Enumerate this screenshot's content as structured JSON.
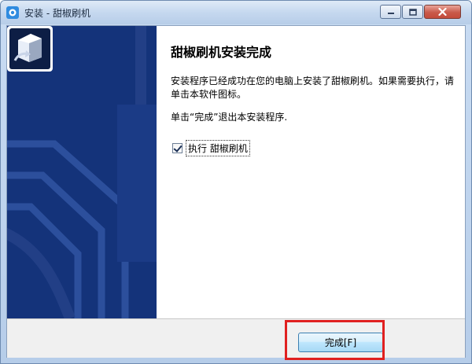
{
  "window": {
    "title": "安装 - 甜椒刷机",
    "icon": "installer-app-icon",
    "controls": [
      "minimize",
      "maximize",
      "close"
    ]
  },
  "page": {
    "heading": "甜椒刷机安装完成",
    "paragraph1": "安装程序已经成功在您的电脑上安装了甜椒刷机。如果需要执行，请单击本软件图标。",
    "paragraph2": "单击“完成”退出本安装程序.",
    "checkbox": {
      "label": "执行 甜椒刷机",
      "checked": true
    }
  },
  "footer": {
    "finish_label": "完成[F]"
  },
  "colors": {
    "side_panel": "#14337a",
    "highlight_border": "#e02020"
  }
}
